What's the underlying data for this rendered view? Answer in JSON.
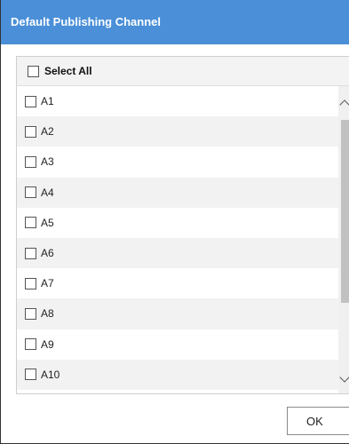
{
  "dialog": {
    "title": "Default Publishing Channel"
  },
  "list": {
    "select_all_label": "Select All",
    "items": [
      {
        "label": "A1",
        "checked": false
      },
      {
        "label": "A2",
        "checked": false
      },
      {
        "label": "A3",
        "checked": false
      },
      {
        "label": "A4",
        "checked": false
      },
      {
        "label": "A5",
        "checked": false
      },
      {
        "label": "A6",
        "checked": false
      },
      {
        "label": "A7",
        "checked": false
      },
      {
        "label": "A8",
        "checked": false
      },
      {
        "label": "A9",
        "checked": false
      },
      {
        "label": "A10",
        "checked": false
      }
    ]
  },
  "buttons": {
    "ok_label": "OK"
  },
  "icons": {
    "scroll_up": "chevron-up-icon",
    "scroll_down": "chevron-down-icon"
  },
  "colors": {
    "titlebar": "#4a8fd8",
    "row_alt": "#f2f2f2",
    "thumb": "#c1c1c1"
  }
}
